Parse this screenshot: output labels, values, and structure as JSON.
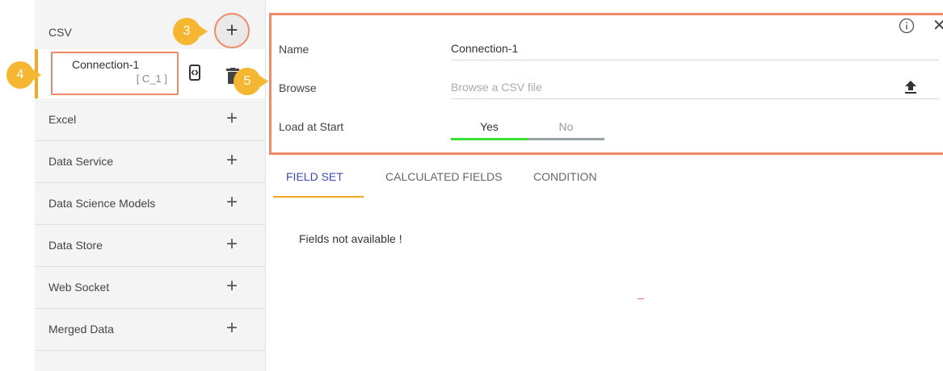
{
  "sidebar": {
    "items": [
      {
        "label": "CSV"
      },
      {
        "label": "Excel"
      },
      {
        "label": "Data Service"
      },
      {
        "label": "Data Science Models"
      },
      {
        "label": "Data Store"
      },
      {
        "label": "Web Socket"
      },
      {
        "label": "Merged Data"
      }
    ],
    "plus_glyph": "+",
    "connection": {
      "name": "Connection-1",
      "id": "[ C_1 ]"
    }
  },
  "callouts": {
    "c3": "3",
    "c4": "4",
    "c5": "5"
  },
  "panel": {
    "name_label": "Name",
    "name_value": "Connection-1",
    "browse_label": "Browse",
    "browse_placeholder": "Browse a CSV file",
    "load_label": "Load at Start",
    "load_yes": "Yes",
    "load_no": "No",
    "close_glyph": "✕"
  },
  "tabs": [
    {
      "label": "FIELD SET"
    },
    {
      "label": "CALCULATED FIELDS"
    },
    {
      "label": "CONDITION"
    }
  ],
  "empty_message": "Fields not available !",
  "colors": {
    "accent": "#f5a623",
    "callout": "#f5b731",
    "highlight_border": "#ee8a68",
    "toggle_on": "#3dde36",
    "active_tab": "#3f4ab0"
  }
}
